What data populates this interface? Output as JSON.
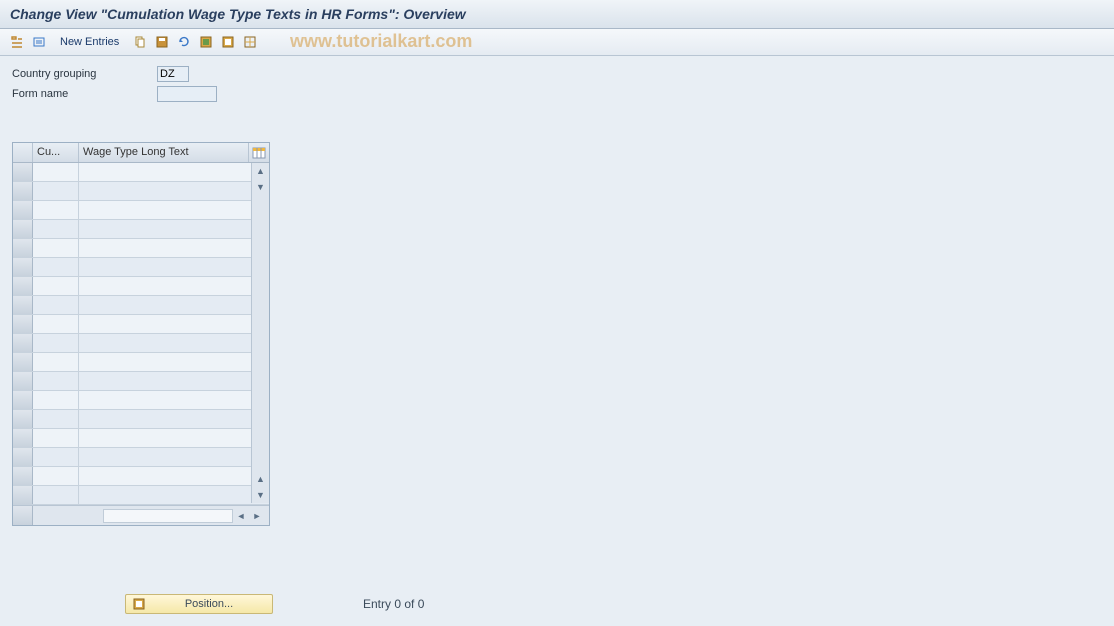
{
  "title": "Change View \"Cumulation Wage Type Texts in HR Forms\": Overview",
  "toolbar": {
    "new_entries": "New Entries"
  },
  "watermark": "www.tutorialkart.com",
  "fields": {
    "country_grouping_label": "Country grouping",
    "country_grouping_value": "DZ",
    "form_name_label": "Form name",
    "form_name_value": ""
  },
  "table": {
    "col_cu": "Cu...",
    "col_wage": "Wage Type Long Text",
    "rows": [
      "",
      "",
      "",
      "",
      "",
      "",
      "",
      "",
      "",
      "",
      "",
      "",
      "",
      "",
      "",
      "",
      "",
      ""
    ]
  },
  "footer": {
    "position_label": "Position...",
    "entry_text": "Entry 0 of 0"
  }
}
